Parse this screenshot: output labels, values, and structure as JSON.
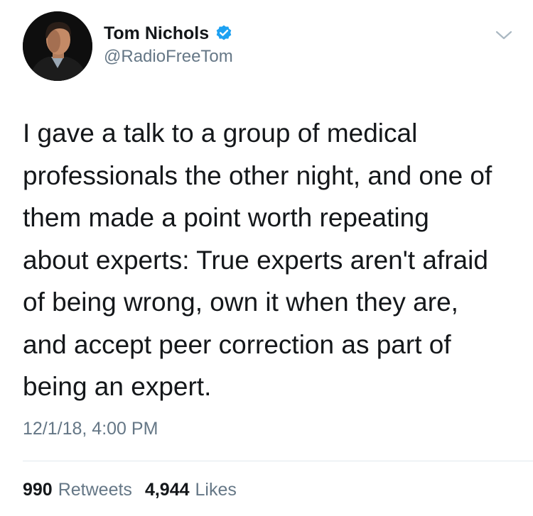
{
  "tweet": {
    "author": {
      "display_name": "Tom Nichols",
      "handle": "@RadioFreeTom",
      "verified": true,
      "avatar_icon": "profile-photo"
    },
    "text": "I gave a talk to a group of medical\nprofessionals the other night, and one of\nthem made a point worth repeating\nabout experts: True experts aren't afraid\nof being wrong, own it when they are,\nand accept peer correction as part of\nbeing an expert.",
    "timestamp": "12/1/18, 4:00 PM",
    "stats": {
      "retweets_count": "990",
      "retweets_label": "Retweets",
      "likes_count": "4,944",
      "likes_label": "Likes"
    }
  },
  "icons": {
    "verified": "verified-badge-icon",
    "menu": "chevron-down-icon"
  },
  "colors": {
    "text_primary": "#14171a",
    "text_secondary": "#657786",
    "verified_blue": "#1da1f2",
    "divider": "#e1e8ed"
  }
}
